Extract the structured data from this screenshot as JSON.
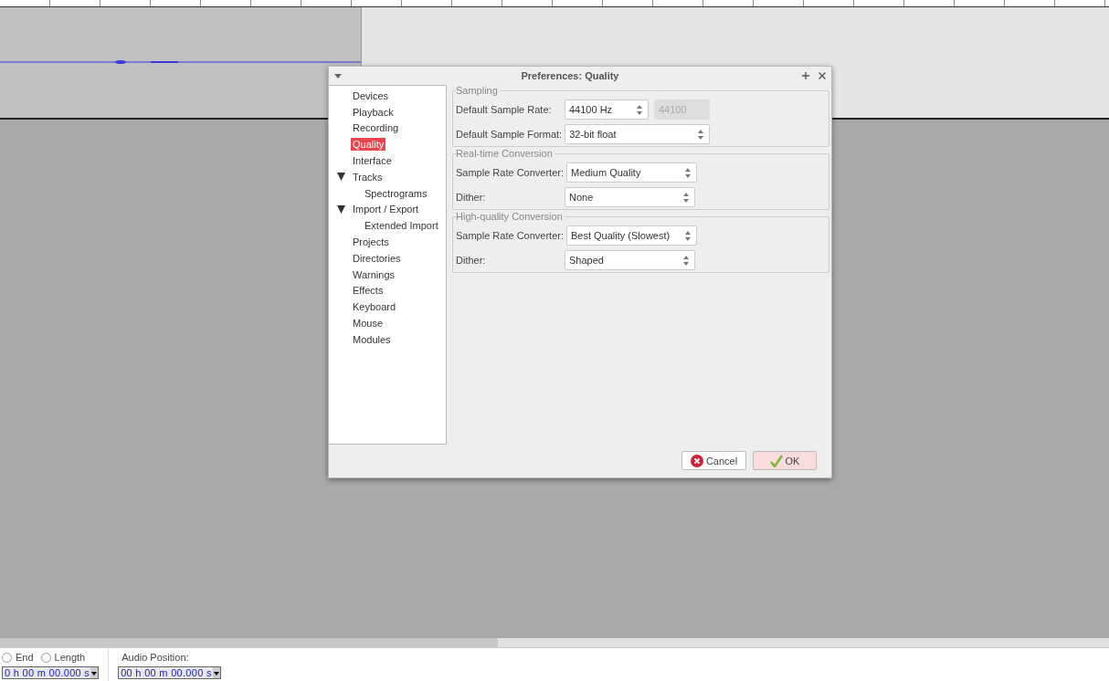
{
  "dialog": {
    "title": "Preferences: Quality",
    "nav": [
      {
        "label": "Devices",
        "selected": false
      },
      {
        "label": "Playback",
        "selected": false
      },
      {
        "label": "Recording",
        "selected": false
      },
      {
        "label": "Quality",
        "selected": true
      },
      {
        "label": "Interface",
        "selected": false
      },
      {
        "label": "Tracks",
        "selected": false,
        "expanded": true,
        "children": [
          {
            "label": "Spectrograms",
            "selected": false
          }
        ]
      },
      {
        "label": "Import / Export",
        "selected": false,
        "expanded": true,
        "children": [
          {
            "label": "Extended Import",
            "selected": false
          }
        ]
      },
      {
        "label": "Projects",
        "selected": false
      },
      {
        "label": "Directories",
        "selected": false
      },
      {
        "label": "Warnings",
        "selected": false
      },
      {
        "label": "Effects",
        "selected": false
      },
      {
        "label": "Keyboard",
        "selected": false
      },
      {
        "label": "Mouse",
        "selected": false
      },
      {
        "label": "Modules",
        "selected": false
      }
    ],
    "groups": [
      {
        "title": "Sampling",
        "rows": [
          {
            "label": "Default Sample Rate:",
            "value": "44100 Hz",
            "extra": {
              "value": "44100",
              "disabled": true
            }
          },
          {
            "label": "Default Sample Format:",
            "value": "32-bit float"
          }
        ]
      },
      {
        "title": "Real-time Conversion",
        "rows": [
          {
            "label": "Sample Rate Converter:",
            "value": "Medium Quality"
          },
          {
            "label": "Dither:",
            "value": "None"
          }
        ]
      },
      {
        "title": "High-quality Conversion",
        "rows": [
          {
            "label": "Sample Rate Converter:",
            "value": "Best Quality (Slowest)"
          },
          {
            "label": "Dither:",
            "value": "Shaped"
          }
        ]
      }
    ],
    "buttons": [
      {
        "label": "Cancel",
        "kind": "cancel"
      },
      {
        "label": "OK",
        "kind": "ok"
      }
    ]
  },
  "selection_toolbar": {
    "radios": [
      {
        "label": "End",
        "selected": false
      },
      {
        "label": "Length",
        "selected": false
      }
    ],
    "audio_position_label": "Audio Position:",
    "times": [
      "0 h 00 m 00.000 s",
      "00 h 00 m 00.000 s"
    ]
  }
}
